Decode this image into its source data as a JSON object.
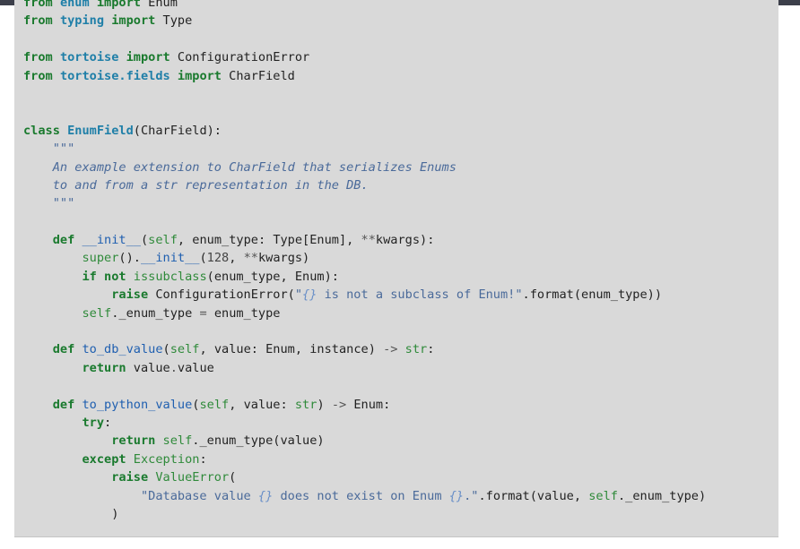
{
  "code_block": {
    "language": "python",
    "lines": [
      [
        {
          "c": "kw",
          "t": "from"
        },
        {
          "c": "txt",
          "t": " "
        },
        {
          "c": "ns",
          "t": "enum"
        },
        {
          "c": "txt",
          "t": " "
        },
        {
          "c": "kw",
          "t": "import"
        },
        {
          "c": "txt",
          "t": " Enum"
        }
      ],
      [
        {
          "c": "kw",
          "t": "from"
        },
        {
          "c": "txt",
          "t": " "
        },
        {
          "c": "ns",
          "t": "typing"
        },
        {
          "c": "txt",
          "t": " "
        },
        {
          "c": "kw",
          "t": "import"
        },
        {
          "c": "txt",
          "t": " Type"
        }
      ],
      [],
      [
        {
          "c": "kw",
          "t": "from"
        },
        {
          "c": "txt",
          "t": " "
        },
        {
          "c": "ns",
          "t": "tortoise"
        },
        {
          "c": "txt",
          "t": " "
        },
        {
          "c": "kw",
          "t": "import"
        },
        {
          "c": "txt",
          "t": " ConfigurationError"
        }
      ],
      [
        {
          "c": "kw",
          "t": "from"
        },
        {
          "c": "txt",
          "t": " "
        },
        {
          "c": "ns",
          "t": "tortoise.fields"
        },
        {
          "c": "txt",
          "t": " "
        },
        {
          "c": "kw",
          "t": "import"
        },
        {
          "c": "txt",
          "t": " CharField"
        }
      ],
      [],
      [],
      [
        {
          "c": "kw",
          "t": "class"
        },
        {
          "c": "txt",
          "t": " "
        },
        {
          "c": "cls",
          "t": "EnumField"
        },
        {
          "c": "txt",
          "t": "(CharField):"
        }
      ],
      [
        {
          "c": "txt",
          "t": "    "
        },
        {
          "c": "doc",
          "t": "\"\"\""
        }
      ],
      [
        {
          "c": "txt",
          "t": "    "
        },
        {
          "c": "doc",
          "t": "An example extension to CharField that serializes Enums"
        }
      ],
      [
        {
          "c": "txt",
          "t": "    "
        },
        {
          "c": "doc",
          "t": "to and from a str representation in the DB."
        }
      ],
      [
        {
          "c": "txt",
          "t": "    "
        },
        {
          "c": "doc",
          "t": "\"\"\""
        }
      ],
      [],
      [
        {
          "c": "txt",
          "t": "    "
        },
        {
          "c": "kw",
          "t": "def"
        },
        {
          "c": "txt",
          "t": " "
        },
        {
          "c": "fn",
          "t": "__init__"
        },
        {
          "c": "txt",
          "t": "("
        },
        {
          "c": "self",
          "t": "self"
        },
        {
          "c": "txt",
          "t": ", enum_type: Type[Enum], "
        },
        {
          "c": "op",
          "t": "**"
        },
        {
          "c": "txt",
          "t": "kwargs):"
        }
      ],
      [
        {
          "c": "txt",
          "t": "        "
        },
        {
          "c": "bi",
          "t": "super"
        },
        {
          "c": "txt",
          "t": "()."
        },
        {
          "c": "fn",
          "t": "__init__"
        },
        {
          "c": "txt",
          "t": "("
        },
        {
          "c": "num",
          "t": "128"
        },
        {
          "c": "txt",
          "t": ", "
        },
        {
          "c": "op",
          "t": "**"
        },
        {
          "c": "txt",
          "t": "kwargs)"
        }
      ],
      [
        {
          "c": "txt",
          "t": "        "
        },
        {
          "c": "kw",
          "t": "if"
        },
        {
          "c": "txt",
          "t": " "
        },
        {
          "c": "kw",
          "t": "not"
        },
        {
          "c": "txt",
          "t": " "
        },
        {
          "c": "bi",
          "t": "issubclass"
        },
        {
          "c": "txt",
          "t": "(enum_type, Enum):"
        }
      ],
      [
        {
          "c": "txt",
          "t": "            "
        },
        {
          "c": "kw",
          "t": "raise"
        },
        {
          "c": "txt",
          "t": " ConfigurationError("
        },
        {
          "c": "str",
          "t": "\""
        },
        {
          "c": "interp",
          "t": "{}"
        },
        {
          "c": "str",
          "t": " is not a subclass of Enum!\""
        },
        {
          "c": "txt",
          "t": ".format(enum_type))"
        }
      ],
      [
        {
          "c": "txt",
          "t": "        "
        },
        {
          "c": "self",
          "t": "self"
        },
        {
          "c": "txt",
          "t": "._enum_type "
        },
        {
          "c": "op",
          "t": "="
        },
        {
          "c": "txt",
          "t": " enum_type"
        }
      ],
      [],
      [
        {
          "c": "txt",
          "t": "    "
        },
        {
          "c": "kw",
          "t": "def"
        },
        {
          "c": "txt",
          "t": " "
        },
        {
          "c": "fn",
          "t": "to_db_value"
        },
        {
          "c": "txt",
          "t": "("
        },
        {
          "c": "self",
          "t": "self"
        },
        {
          "c": "txt",
          "t": ", value: Enum, instance) "
        },
        {
          "c": "op",
          "t": "->"
        },
        {
          "c": "txt",
          "t": " "
        },
        {
          "c": "bi",
          "t": "str"
        },
        {
          "c": "txt",
          "t": ":"
        }
      ],
      [
        {
          "c": "txt",
          "t": "        "
        },
        {
          "c": "kw",
          "t": "return"
        },
        {
          "c": "txt",
          "t": " value"
        },
        {
          "c": "op",
          "t": "."
        },
        {
          "c": "txt",
          "t": "value"
        }
      ],
      [],
      [
        {
          "c": "txt",
          "t": "    "
        },
        {
          "c": "kw",
          "t": "def"
        },
        {
          "c": "txt",
          "t": " "
        },
        {
          "c": "fn",
          "t": "to_python_value"
        },
        {
          "c": "txt",
          "t": "("
        },
        {
          "c": "self",
          "t": "self"
        },
        {
          "c": "txt",
          "t": ", value: "
        },
        {
          "c": "bi",
          "t": "str"
        },
        {
          "c": "txt",
          "t": ") "
        },
        {
          "c": "op",
          "t": "->"
        },
        {
          "c": "txt",
          "t": " Enum:"
        }
      ],
      [
        {
          "c": "txt",
          "t": "        "
        },
        {
          "c": "kw",
          "t": "try"
        },
        {
          "c": "txt",
          "t": ":"
        }
      ],
      [
        {
          "c": "txt",
          "t": "            "
        },
        {
          "c": "kw",
          "t": "return"
        },
        {
          "c": "txt",
          "t": " "
        },
        {
          "c": "self",
          "t": "self"
        },
        {
          "c": "txt",
          "t": "._enum_type(value)"
        }
      ],
      [
        {
          "c": "txt",
          "t": "        "
        },
        {
          "c": "kw",
          "t": "except"
        },
        {
          "c": "txt",
          "t": " "
        },
        {
          "c": "bi",
          "t": "Exception"
        },
        {
          "c": "txt",
          "t": ":"
        }
      ],
      [
        {
          "c": "txt",
          "t": "            "
        },
        {
          "c": "kw",
          "t": "raise"
        },
        {
          "c": "txt",
          "t": " "
        },
        {
          "c": "bi",
          "t": "ValueError"
        },
        {
          "c": "txt",
          "t": "("
        }
      ],
      [
        {
          "c": "txt",
          "t": "                "
        },
        {
          "c": "str",
          "t": "\"Database value "
        },
        {
          "c": "interp",
          "t": "{}"
        },
        {
          "c": "str",
          "t": " does not exist on Enum "
        },
        {
          "c": "interp",
          "t": "{}"
        },
        {
          "c": "str",
          "t": ".\""
        },
        {
          "c": "txt",
          "t": ".format(value, "
        },
        {
          "c": "self",
          "t": "self"
        },
        {
          "c": "txt",
          "t": "._enum_type)"
        }
      ],
      [
        {
          "c": "txt",
          "t": "            )"
        }
      ]
    ]
  },
  "colors": {
    "background": "#d9d9d9",
    "keyword": "#1a7a2e",
    "module": "#1f7fa8",
    "function": "#1f5fb0",
    "builtin": "#2f8a3a",
    "string": "#4a6a9a",
    "docstring": "#4a6a9a"
  }
}
